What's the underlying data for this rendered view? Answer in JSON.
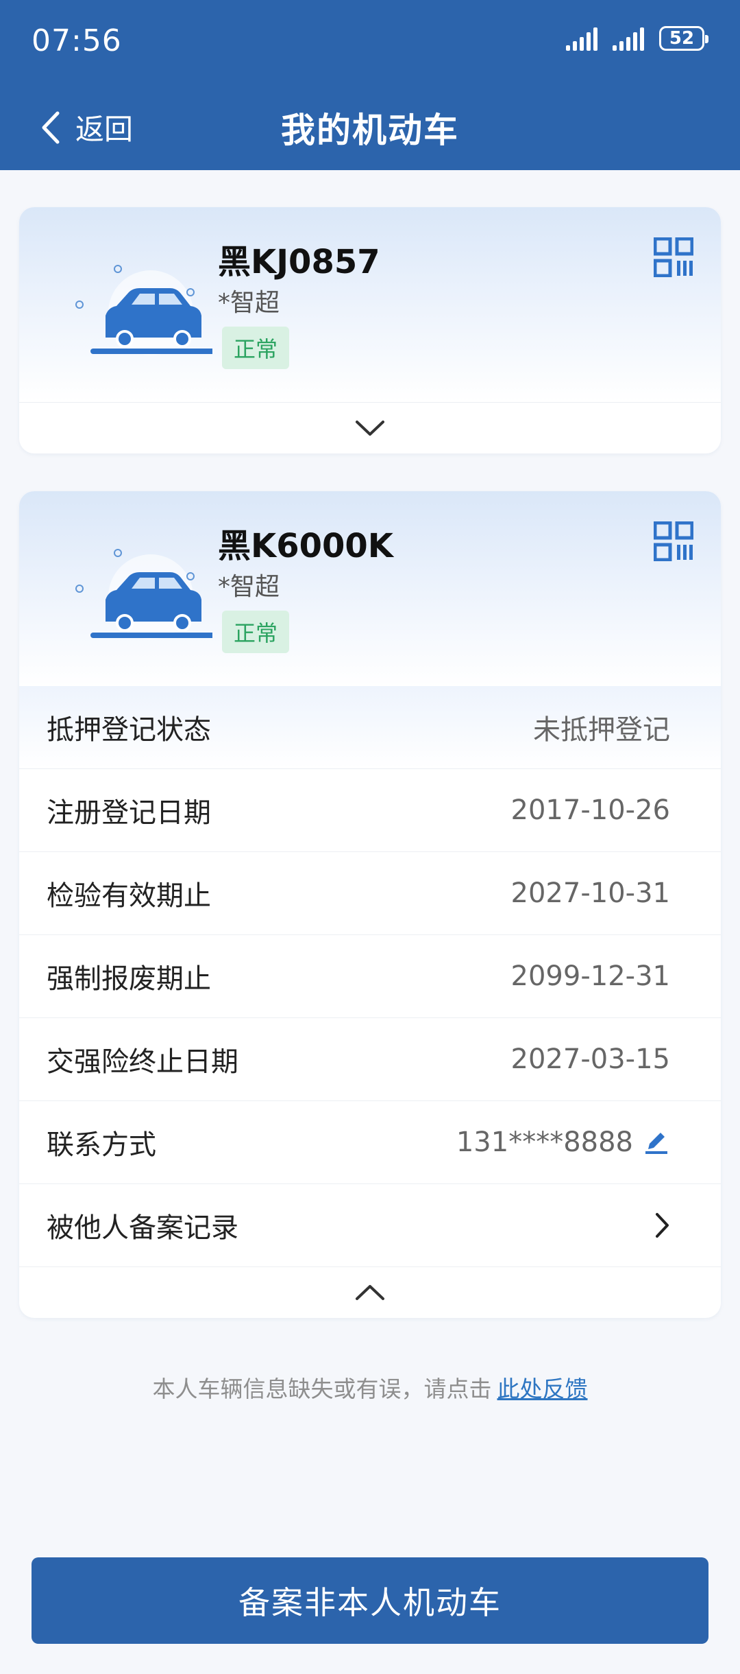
{
  "status_bar": {
    "time": "07:56",
    "battery": "52"
  },
  "header": {
    "back_label": "返回",
    "title": "我的机动车"
  },
  "vehicles": [
    {
      "plate": "黑KJ0857",
      "owner": "*智超",
      "status": "正常"
    },
    {
      "plate": "黑K6000K",
      "owner": "*智超",
      "status": "正常",
      "details": [
        {
          "label": "抵押登记状态",
          "value": "未抵押登记"
        },
        {
          "label": "注册登记日期",
          "value": "2017-10-26"
        },
        {
          "label": "检验有效期止",
          "value": "2027-10-31"
        },
        {
          "label": "强制报废期止",
          "value": "2099-12-31"
        },
        {
          "label": "交强险终止日期",
          "value": "2027-03-15"
        },
        {
          "label": "联系方式",
          "value": "131****8888"
        },
        {
          "label": "被他人备案记录",
          "value": ""
        }
      ]
    }
  ],
  "feedback": {
    "text": "本人车辆信息缺失或有误，请点击",
    "link": "此处反馈"
  },
  "bottom_button": "备案非本人机动车",
  "colors": {
    "primary": "#2c64ac",
    "status_green": "#2ba360",
    "link": "#2e76c2"
  }
}
